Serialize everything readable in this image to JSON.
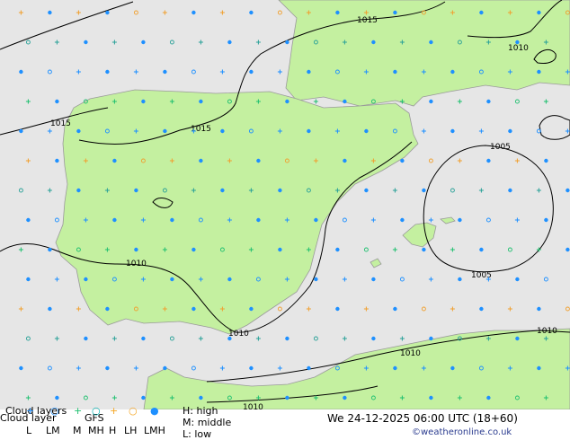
{
  "colors": {
    "sea": "#e6e6e6",
    "land": "#c4f0a0",
    "coast": "#9a9a9a",
    "isobar": "#000000",
    "sym_low": "#1e90ff",
    "sym_middle": "#00b2b2",
    "sym_high": "#f5a623",
    "sym_cyan": "#2aa198",
    "sym_green": "#20c070",
    "sym_orange": "#f0a030"
  },
  "isobar_labels": [
    "1015",
    "1015",
    "1015",
    "1010",
    "1005",
    "1005",
    "1010",
    "1010",
    "1010",
    "1010",
    "1010"
  ],
  "legend": {
    "title_overlay": "Cloud layers",
    "title": "Cloud layer",
    "model": "GFS",
    "keys": [
      {
        "label": "L",
        "glyph": "+",
        "color": "#1e90ff"
      },
      {
        "label": "LM",
        "glyph": "○",
        "color": "#1e90ff"
      },
      {
        "label": "M",
        "glyph": "+",
        "color": "#20c070"
      },
      {
        "label": "MH",
        "glyph": "○",
        "color": "#00b2b2"
      },
      {
        "label": "H",
        "glyph": "+",
        "color": "#f5a623"
      },
      {
        "label": "LH",
        "glyph": "○",
        "color": "#f5a623"
      },
      {
        "label": "LMH",
        "glyph": "●",
        "color": "#1e90ff"
      }
    ],
    "level_high": "H: high",
    "level_middle": "M: middle",
    "level_low": "L: low",
    "datetime": "We 24-12-2025 06:00 UTC (18+60)",
    "credit": "©weatheronline.co.uk"
  }
}
